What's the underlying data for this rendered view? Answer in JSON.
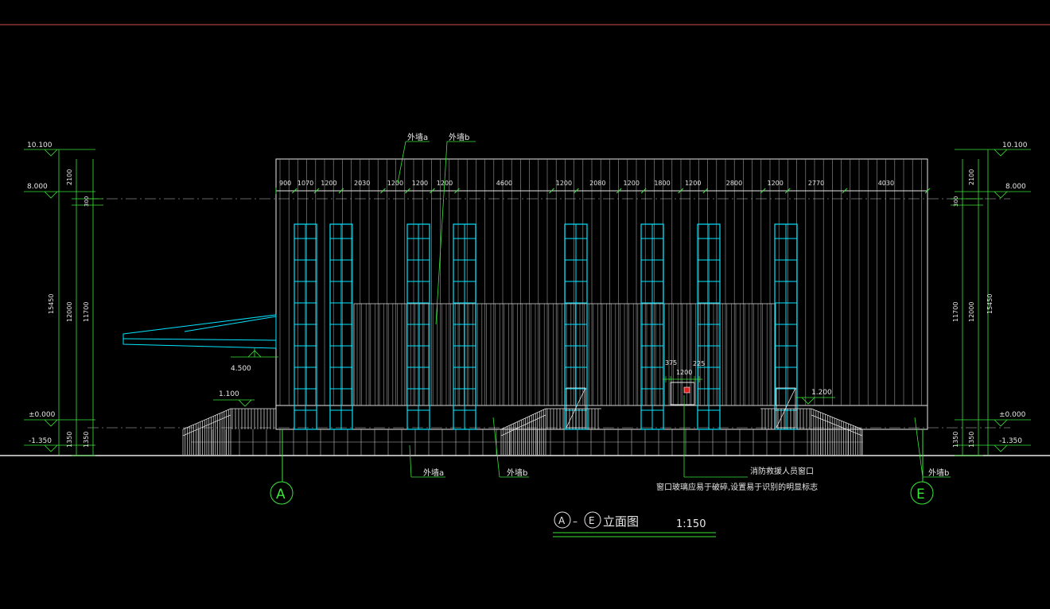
{
  "drawing": {
    "title": "立面图",
    "scale": "1:150",
    "axis_start": "A",
    "axis_end": "E",
    "title_dash": "–"
  },
  "elevations": {
    "top": "10.100",
    "eave": "8.000",
    "floor": "±0.000",
    "ground": "-1.350",
    "canopy": "4.500",
    "stair_left": "1.100",
    "stair_right": "1.200"
  },
  "dims_left": {
    "total": "15450",
    "d12000": "12000",
    "d11700": "11700",
    "d2100": "2100",
    "d300": "300",
    "d1350a": "1350",
    "d1350b": "1350"
  },
  "dims_right": {
    "total": "15450",
    "d12000": "12000",
    "d11700": "11700",
    "d2100": "2100",
    "d300": "300",
    "d1350a": "1350",
    "d1350b": "1350"
  },
  "top_dims": [
    "900",
    "1070",
    "1200",
    "2030",
    "1200",
    "1200",
    "1200",
    "4600",
    "1200",
    "2080",
    "1200",
    "1800",
    "1200",
    "2800",
    "1200",
    "2770",
    "4030"
  ],
  "window_dims": {
    "left": "375",
    "width": "1200",
    "right": "225"
  },
  "labels": {
    "wall_a_top": "外墙a",
    "wall_b_top": "外墙b",
    "wall_a_bottom": "外墙a",
    "wall_b_bottom": "外墙b",
    "wall_b_right": "外墙b",
    "rescue_window": "消防救援人员窗口",
    "rescue_note": "窗口玻璃应易于破碎,设置易于识别的明显标志"
  }
}
